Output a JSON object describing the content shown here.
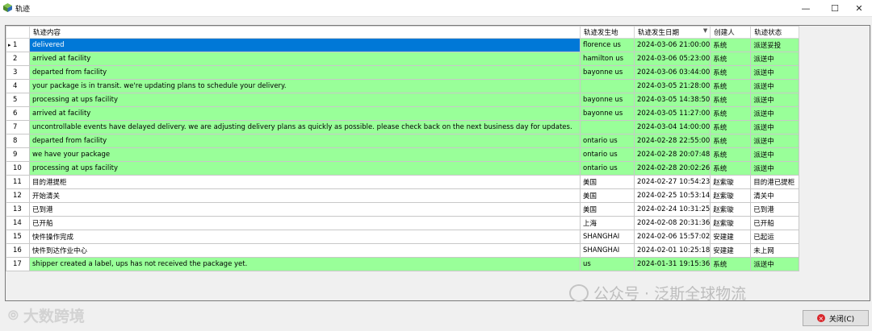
{
  "window": {
    "title": "轨迹",
    "minimize": "—",
    "maximize": "☐",
    "close": "✕"
  },
  "columns": [
    "轨迹内容",
    "轨迹发生地",
    "轨迹发生日期",
    "创建人",
    "轨迹状态"
  ],
  "sort_indicator": "▼",
  "current_row_marker": "▸",
  "rows": [
    {
      "n": "1",
      "content": "delivered",
      "place": "florence us",
      "date": "2024-03-06 21:00:00",
      "creator": "系统",
      "status": "派送妥投",
      "green": true
    },
    {
      "n": "2",
      "content": "arrived at facility",
      "place": "hamilton us",
      "date": "2024-03-06 05:23:00",
      "creator": "系统",
      "status": "派送中",
      "green": true
    },
    {
      "n": "3",
      "content": "departed from facility",
      "place": "bayonne us",
      "date": "2024-03-06 03:44:00",
      "creator": "系统",
      "status": "派送中",
      "green": true
    },
    {
      "n": "4",
      "content": "your package is in transit. we're updating plans to schedule your delivery.",
      "place": "",
      "date": "2024-03-05 21:28:00",
      "creator": "系统",
      "status": "派送中",
      "green": true
    },
    {
      "n": "5",
      "content": "processing at ups facility",
      "place": "bayonne us",
      "date": "2024-03-05 14:38:50",
      "creator": "系统",
      "status": "派送中",
      "green": true
    },
    {
      "n": "6",
      "content": "arrived at facility",
      "place": "bayonne us",
      "date": "2024-03-05 11:27:00",
      "creator": "系统",
      "status": "派送中",
      "green": true
    },
    {
      "n": "7",
      "content": "uncontrollable events have delayed delivery. we are adjusting delivery plans as quickly as possible. please check back on the next business day for updates.",
      "place": "",
      "date": "2024-03-04 14:00:00",
      "creator": "系统",
      "status": "派送中",
      "green": true
    },
    {
      "n": "8",
      "content": "departed from facility",
      "place": "ontario us",
      "date": "2024-02-28 22:55:00",
      "creator": "系统",
      "status": "派送中",
      "green": true
    },
    {
      "n": "9",
      "content": "we have your package",
      "place": "ontario us",
      "date": "2024-02-28 20:07:48",
      "creator": "系统",
      "status": "派送中",
      "green": true
    },
    {
      "n": "10",
      "content": "processing at ups facility",
      "place": "ontario us",
      "date": "2024-02-28 20:02:26",
      "creator": "系统",
      "status": "派送中",
      "green": true
    },
    {
      "n": "11",
      "content": "目的港提柜",
      "place": "美国",
      "date": "2024-02-27 10:54:23",
      "creator": "赵紫璇",
      "status": "目的港已提柜",
      "green": false
    },
    {
      "n": "12",
      "content": "开始清关",
      "place": "美国",
      "date": "2024-02-25 10:53:14",
      "creator": "赵紫璇",
      "status": "清关中",
      "green": false
    },
    {
      "n": "13",
      "content": "已到港",
      "place": "美国",
      "date": "2024-02-24 10:31:25",
      "creator": "赵紫璇",
      "status": "已到港",
      "green": false
    },
    {
      "n": "14",
      "content": "已开船",
      "place": "上海",
      "date": "2024-02-08 20:31:36",
      "creator": "赵紫璇",
      "status": "已开船",
      "green": false
    },
    {
      "n": "15",
      "content": "快件操作完成",
      "place": "SHANGHAI",
      "date": "2024-02-06 15:57:02",
      "creator": "安建建",
      "status": "已起运",
      "green": false
    },
    {
      "n": "16",
      "content": "快件到达作业中心",
      "place": "SHANGHAI",
      "date": "2024-02-01 10:25:18",
      "creator": "安建建",
      "status": "未上网",
      "green": false
    },
    {
      "n": "17",
      "content": "shipper created a label, ups has not received the package yet.",
      "place": " us",
      "date": "2024-01-31 19:15:36",
      "creator": "系统",
      "status": "派送中",
      "green": true
    }
  ],
  "watermark_text": "公众号 · 泛斯全球物流",
  "watermark2_text": "大数跨境",
  "close_button_label": "关闭(C)",
  "colors": {
    "row_green": "#99ff99",
    "selected": "#0078d7"
  }
}
